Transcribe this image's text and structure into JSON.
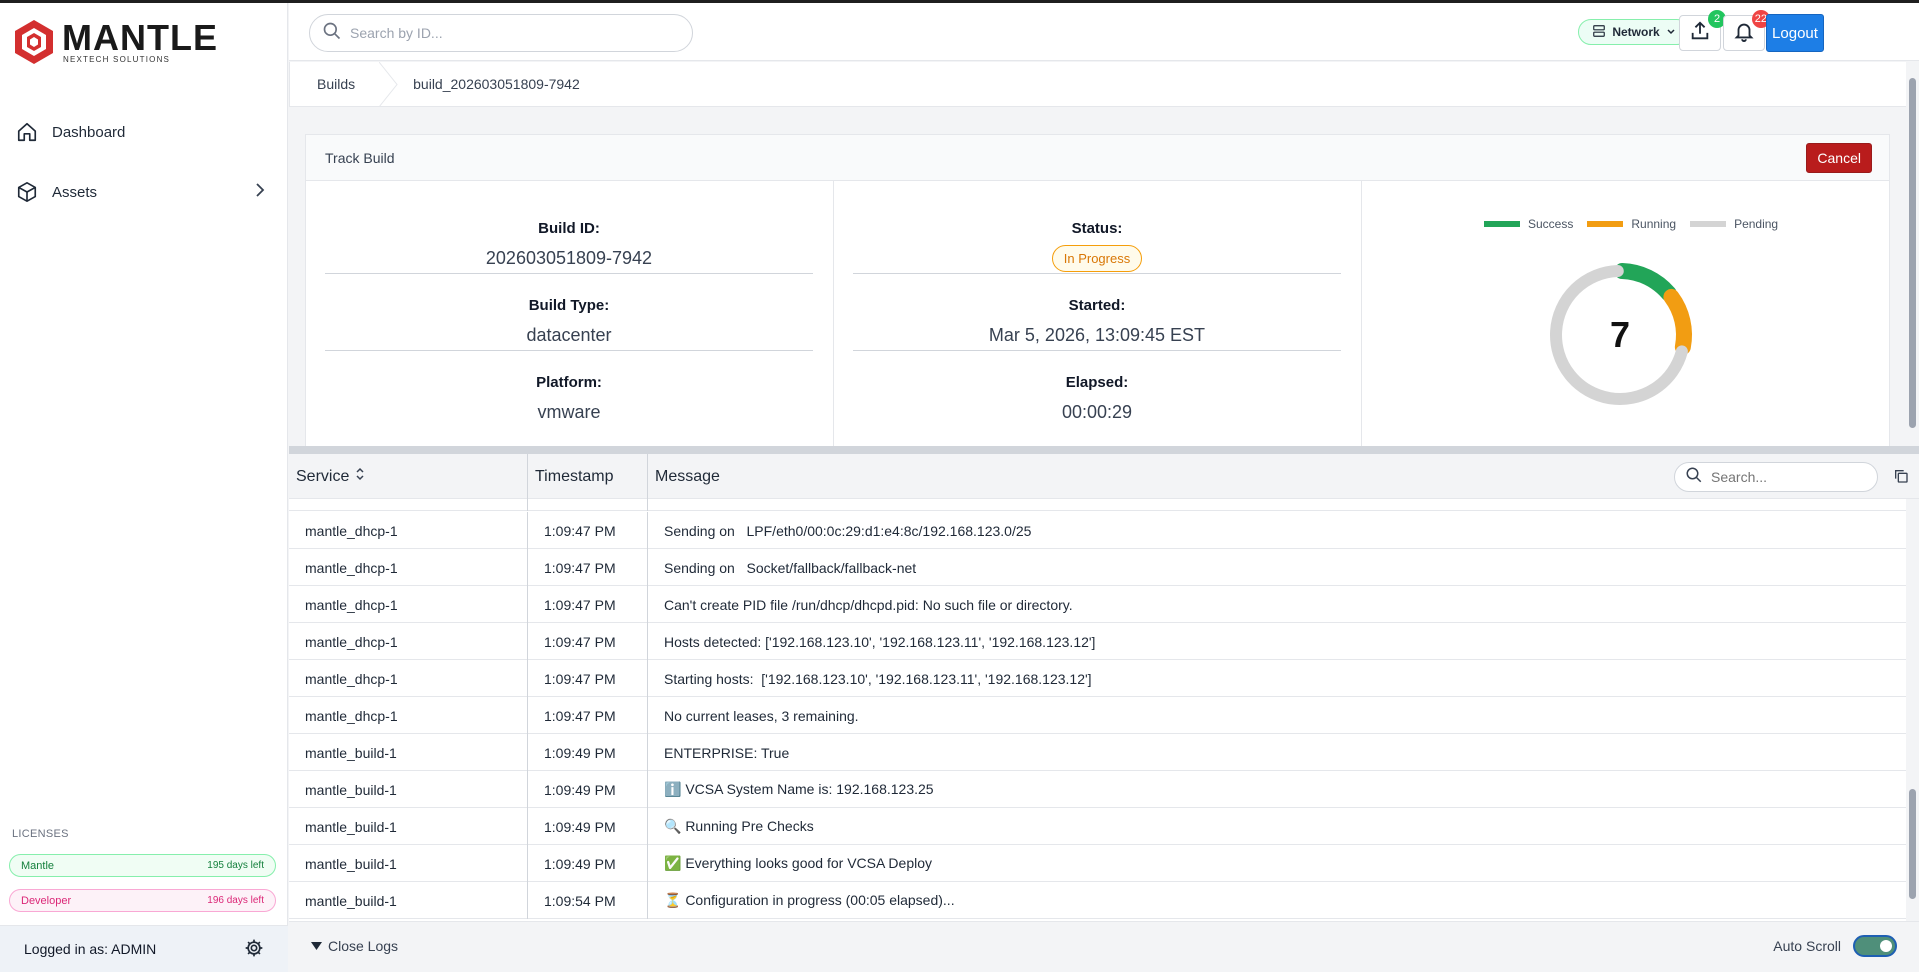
{
  "brand": {
    "name": "MANTLE",
    "tagline": "NEXTECH SOLUTIONS",
    "color": "#d32f2f"
  },
  "sidebar": {
    "items": [
      {
        "label": "Dashboard",
        "icon": "home-icon"
      },
      {
        "label": "Assets",
        "icon": "assets-icon"
      }
    ],
    "licenses_label": "LICENSES",
    "licenses": [
      {
        "name": "Mantle",
        "days": "195 days left"
      },
      {
        "name": "Developer",
        "days": "196 days left"
      }
    ],
    "user_label": "Logged in as: ADMIN"
  },
  "header": {
    "search_placeholder": "Search by ID...",
    "network_label": "Network",
    "upload_count": "2",
    "notif_count": "22",
    "logout_label": "Logout"
  },
  "breadcrumb": {
    "root": "Builds",
    "current": "build_202603051809-7942"
  },
  "track": {
    "title": "Track Build",
    "cancel_label": "Cancel",
    "build_id_label": "Build ID:",
    "build_id": "202603051809-7942",
    "build_type_label": "Build Type:",
    "build_type": "datacenter",
    "platform_label": "Platform:",
    "platform": "vmware",
    "status_label": "Status:",
    "status": "In Progress",
    "started_label": "Started:",
    "started": "Mar 5, 2026, 13:09:45 EST",
    "elapsed_label": "Elapsed:",
    "elapsed": "00:00:29",
    "legend": [
      {
        "name": "Success",
        "color": "#22a558"
      },
      {
        "name": "Running",
        "color": "#f29d12"
      },
      {
        "name": "Pending",
        "color": "#d4d4d4"
      }
    ],
    "donut_center": "7",
    "segments": {
      "success": 1,
      "running": 1,
      "pending": 5
    }
  },
  "logs": {
    "columns": {
      "service": "Service",
      "timestamp": "Timestamp",
      "message": "Message"
    },
    "search_placeholder": "Search...",
    "rows": [
      {
        "service": "mantle_dhcp-1",
        "time": "1:09:47 PM",
        "msg": "Sending on   LPF/eth0/00:0c:29:d1:e4:8c/192.168.123.0/25"
      },
      {
        "service": "mantle_dhcp-1",
        "time": "1:09:47 PM",
        "msg": "Sending on   Socket/fallback/fallback-net"
      },
      {
        "service": "mantle_dhcp-1",
        "time": "1:09:47 PM",
        "msg": "Can't create PID file /run/dhcp/dhcpd.pid: No such file or directory."
      },
      {
        "service": "mantle_dhcp-1",
        "time": "1:09:47 PM",
        "msg": "Hosts detected: ['192.168.123.10', '192.168.123.11', '192.168.123.12']"
      },
      {
        "service": "mantle_dhcp-1",
        "time": "1:09:47 PM",
        "msg": "Starting hosts:  ['192.168.123.10', '192.168.123.11', '192.168.123.12']"
      },
      {
        "service": "mantle_dhcp-1",
        "time": "1:09:47 PM",
        "msg": "No current leases, 3 remaining."
      },
      {
        "service": "mantle_build-1",
        "time": "1:09:49 PM",
        "msg": "ENTERPRISE: True"
      },
      {
        "service": "mantle_build-1",
        "time": "1:09:49 PM",
        "msg": "ℹ️ VCSA System Name is: 192.168.123.25"
      },
      {
        "service": "mantle_build-1",
        "time": "1:09:49 PM",
        "msg": "🔍 Running Pre Checks"
      },
      {
        "service": "mantle_build-1",
        "time": "1:09:49 PM",
        "msg": "✅ Everything looks good for VCSA Deploy"
      },
      {
        "service": "mantle_build-1",
        "time": "1:09:54 PM",
        "msg": "⏳ Configuration in progress (00:05 elapsed)..."
      }
    ],
    "close_label": "Close Logs",
    "auto_scroll_label": "Auto Scroll"
  }
}
